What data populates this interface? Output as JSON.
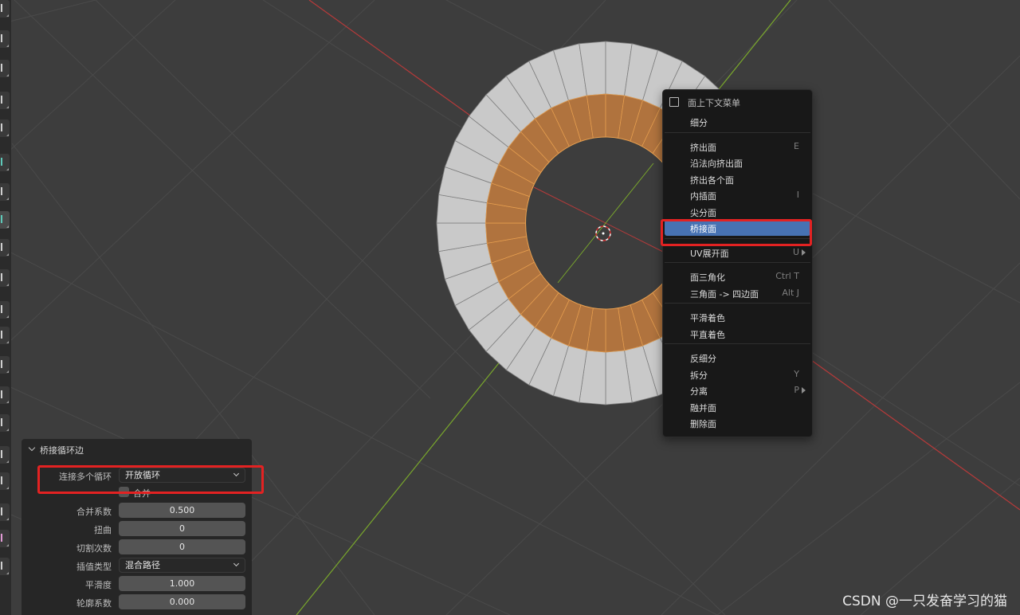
{
  "context_menu": {
    "title": "面上下文菜单",
    "groups": [
      [
        {
          "label": "细分",
          "shortcut": ""
        }
      ],
      [
        {
          "label": "挤出面",
          "shortcut": "E"
        },
        {
          "label": "沿法向挤出面",
          "shortcut": ""
        },
        {
          "label": "挤出各个面",
          "shortcut": ""
        },
        {
          "label": "内插面",
          "shortcut": "I"
        },
        {
          "label": "尖分面",
          "shortcut": ""
        },
        {
          "label": "桥接面",
          "shortcut": "",
          "highlighted": true
        }
      ],
      [
        {
          "label": "UV展开面",
          "shortcut": "U",
          "submenu": true
        }
      ],
      [
        {
          "label": "面三角化",
          "shortcut": "Ctrl T"
        },
        {
          "label": "三角面 -> 四边面",
          "shortcut": "Alt J"
        }
      ],
      [
        {
          "label": "平滑着色",
          "shortcut": ""
        },
        {
          "label": "平直着色",
          "shortcut": ""
        }
      ],
      [
        {
          "label": "反细分",
          "shortcut": ""
        },
        {
          "label": "拆分",
          "shortcut": "Y"
        },
        {
          "label": "分离",
          "shortcut": "P",
          "submenu": true
        },
        {
          "label": "融并面",
          "shortcut": ""
        },
        {
          "label": "删除面",
          "shortcut": ""
        }
      ]
    ]
  },
  "operator_panel": {
    "title": "桥接循环边",
    "rows": [
      {
        "kind": "select",
        "label": "连接多个循环",
        "value": "开放循环"
      },
      {
        "kind": "checkbox",
        "label": "合并",
        "checked": false
      },
      {
        "kind": "number",
        "label": "合并系数",
        "value": "0.500"
      },
      {
        "kind": "number",
        "label": "扭曲",
        "value": "0"
      },
      {
        "kind": "number",
        "label": "切割次数",
        "value": "0"
      },
      {
        "kind": "select",
        "label": "插值类型",
        "value": "混合路径"
      },
      {
        "kind": "number",
        "label": "平滑度",
        "value": "1.000"
      },
      {
        "kind": "number",
        "label": "轮廓系数",
        "value": "0.000"
      }
    ]
  },
  "watermark": "CSDN @一只发奋学习的猫",
  "colors": {
    "viewport_bg": "#3d3d3d",
    "menu_bg": "#181818",
    "highlight": "#4772b3",
    "annotation_red": "#e32222",
    "x_axis": "#b83a3a",
    "y_axis": "#7aa82c",
    "face_orange": "#b0733e",
    "mesh_gray": "#c9c9c9"
  }
}
